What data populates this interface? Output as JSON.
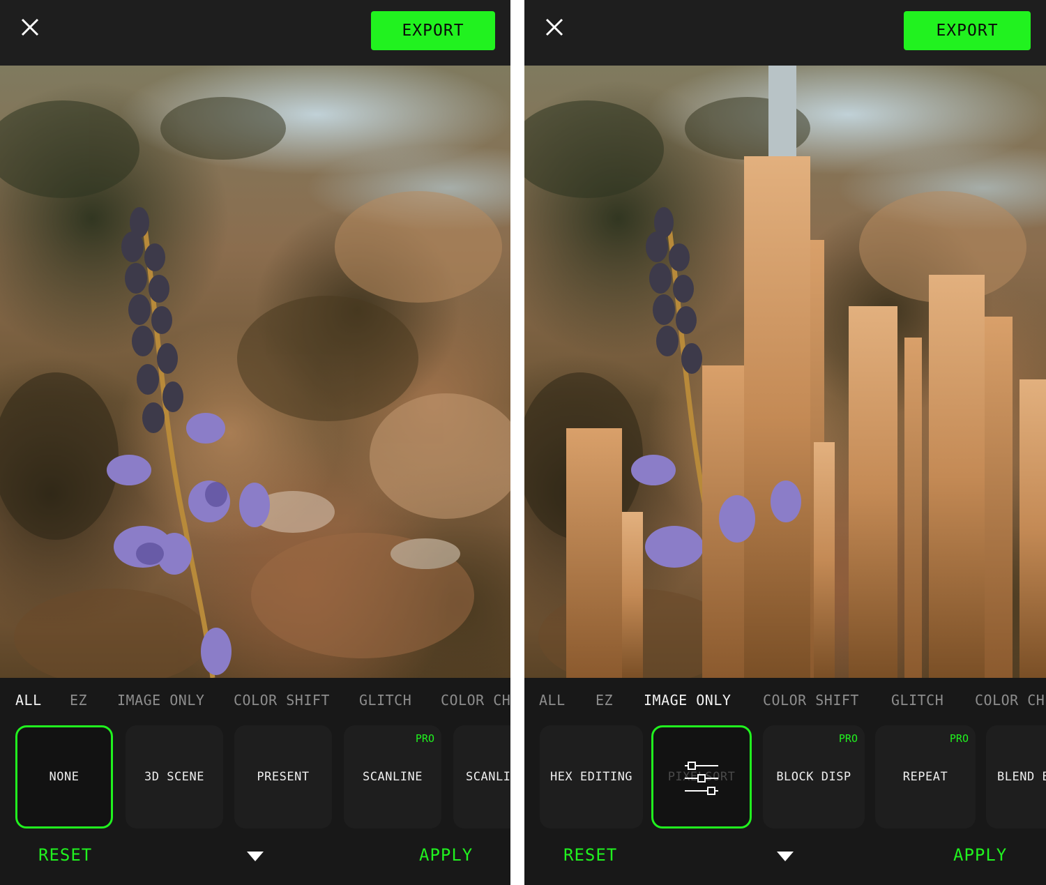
{
  "left": {
    "export_label": "EXPORT",
    "categories": [
      "ALL",
      "EZ",
      "IMAGE ONLY",
      "COLOR SHIFT",
      "GLITCH",
      "COLOR CH"
    ],
    "active_category": "ALL",
    "tiles": [
      {
        "label": "NONE",
        "pro": "",
        "selected": true
      },
      {
        "label": "3D SCENE",
        "pro": ""
      },
      {
        "label": "PRESENT",
        "pro": ""
      },
      {
        "label": "SCANLINE",
        "pro": "PRO"
      },
      {
        "label": "SCANLI",
        "pro": ""
      }
    ],
    "reset_label": "RESET",
    "apply_label": "APPLY"
  },
  "right": {
    "export_label": "EXPORT",
    "categories": [
      "ALL",
      "EZ",
      "IMAGE ONLY",
      "COLOR SHIFT",
      "GLITCH",
      "COLOR CH"
    ],
    "active_category": "IMAGE ONLY",
    "tiles": [
      {
        "label": "HEX EDITING",
        "pro": ""
      },
      {
        "label": "PIXELSORT",
        "pro": "",
        "selected": true
      },
      {
        "label": "BLOCK DISP",
        "pro": "PRO"
      },
      {
        "label": "REPEAT",
        "pro": "PRO"
      },
      {
        "label": "BLEND E",
        "pro": ""
      }
    ],
    "reset_label": "RESET",
    "apply_label": "APPLY"
  },
  "icons": {
    "close": "close-icon",
    "collapse": "chevron-down-icon",
    "adjust": "sliders-icon"
  },
  "colors": {
    "accent": "#21f21f",
    "panel_bg": "#181818",
    "topbar_bg": "#1e1e1e",
    "inactive_text": "#8d8d8d"
  }
}
